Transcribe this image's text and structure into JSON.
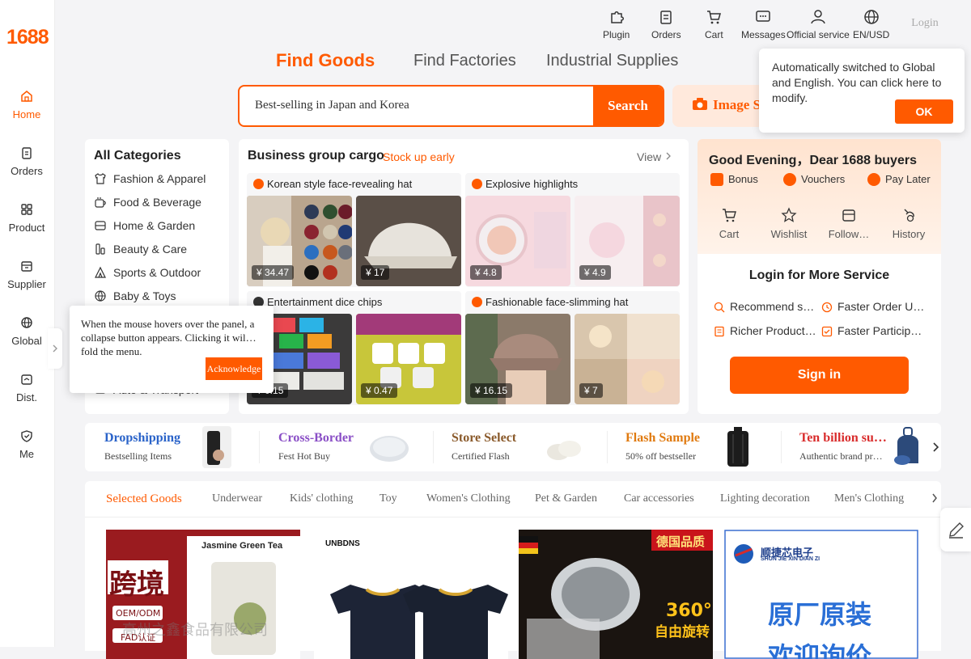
{
  "logo": "1688",
  "sidebar": {
    "items": [
      {
        "label": "Home",
        "icon": "home-icon"
      },
      {
        "label": "Orders",
        "icon": "orders-icon"
      },
      {
        "label": "Product",
        "icon": "product-icon"
      },
      {
        "label": "Supplier",
        "icon": "supplier-icon"
      },
      {
        "label": "Global",
        "icon": "globe-icon"
      },
      {
        "label": "Dist.",
        "icon": "distribution-icon"
      },
      {
        "label": "Me",
        "icon": "me-icon"
      }
    ]
  },
  "topnav": {
    "items": [
      {
        "label": "Plugin",
        "icon": "puzzle-icon"
      },
      {
        "label": "Orders",
        "icon": "clipboard-icon"
      },
      {
        "label": "Cart",
        "icon": "cart-icon"
      },
      {
        "label": "Messages",
        "icon": "message-icon"
      },
      {
        "label": "Official service",
        "icon": "user-icon"
      },
      {
        "label": "EN/USD",
        "icon": "globe-icon"
      }
    ],
    "login": "Login"
  },
  "tabs": [
    "Find Goods",
    "Find Factories",
    "Industrial Supplies"
  ],
  "search": {
    "value": "Best-selling in Japan and Korea",
    "button": "Search",
    "image_search": "Image S"
  },
  "lang_popup": {
    "text": "Automatically switched to Global and English. You can click here to modify.",
    "ok": "OK"
  },
  "categories": {
    "title": "All Categories",
    "items": [
      "Fashion & Apparel",
      "Food & Beverage",
      "Home & Garden",
      "Beauty & Care",
      "Sports & Outdoor",
      "Baby & Toys"
    ],
    "hidden_partial": "Auto & Transport"
  },
  "hover_tip": {
    "text": "When the mouse hovers over the panel, a collapse button appears. Clicking it wil… fold the menu.",
    "button": "Acknowledge"
  },
  "business_group": {
    "title": "Business group cargo",
    "subtitle": "Stock up early",
    "view": "View",
    "cards": [
      {
        "title": "Korean style face-revealing hat",
        "prices": [
          "¥ 34.47",
          "¥ 17"
        ]
      },
      {
        "title": "Explosive highlights",
        "prices": [
          "¥ 4.8",
          "¥ 4.9"
        ]
      },
      {
        "title": "Entertainment dice chips",
        "prices": [
          "¥ 0.15",
          "¥ 0.47"
        ]
      },
      {
        "title": "Fashionable face-slimming hat",
        "prices": [
          "¥ 16.15",
          "¥ 7"
        ]
      }
    ]
  },
  "greeting": {
    "title": "Good Evening，Dear 1688 buyers",
    "quick": [
      "Bonus",
      "Vouchers",
      "Pay Later"
    ],
    "icons": [
      "Cart",
      "Wishlist",
      "Follow…",
      "History"
    ],
    "login_more": "Login for More Service",
    "services": [
      "Recommend s…",
      "Faster Order U…",
      "Richer Product …",
      "Faster Particip…"
    ],
    "signin": "Sign in"
  },
  "promo": [
    {
      "title": "Dropshipping",
      "sub": "Bestselling Items",
      "color": "#2a63c9"
    },
    {
      "title": "Cross-Border",
      "sub": "Fest Hot Buy",
      "color": "#8a4fc6"
    },
    {
      "title": "Store Select",
      "sub": "Certified Flash",
      "color": "#8a5a2b"
    },
    {
      "title": "Flash Sample",
      "sub": "50% off bestseller",
      "color": "#e07a10"
    },
    {
      "title": "Ten billion su…",
      "sub": "Authentic brand pr…",
      "color": "#d92c2c"
    }
  ],
  "goods": {
    "tabs": [
      "Selected Goods",
      "Underwear",
      "Kids' clothing",
      "Toy",
      "Women's Clothing",
      "Pet & Garden",
      "Car accessories",
      "Lighting decoration",
      "Men's Clothing"
    ],
    "products": [
      {
        "banner": "跨境",
        "tag1": "OEM/ODM",
        "tag2": "FAD认证",
        "label": "Jasmine Green Tea",
        "watermark": "高州之鑫食品有限公司"
      },
      {
        "label": "UNBDNS"
      },
      {
        "tag": "德国品质",
        "label": "360°",
        "sub": "自由旋转"
      },
      {
        "brand_cn": "顺捷芯电子",
        "brand_en": "SHUN JIE XIN DIAN ZI",
        "label": "原厂原装",
        "sub": "欢迎询价"
      }
    ]
  },
  "accent": "#ff5a00"
}
